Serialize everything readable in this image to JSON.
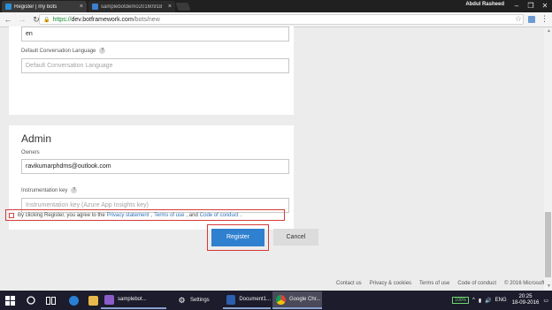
{
  "browser": {
    "tabs": [
      {
        "title": "Register | my bots",
        "close": "×"
      },
      {
        "title": "samplebotdemo20160918",
        "close": "×"
      }
    ],
    "user": "Abdul Rasheed",
    "win_controls": [
      "–",
      "❐",
      "✕"
    ],
    "url": {
      "scheme": "https://",
      "host": "dev.botframework.com",
      "path": "/bots/new"
    }
  },
  "form": {
    "language_value": "en",
    "default_conv_lang": {
      "label": "Default Conversation Language",
      "help": "?",
      "placeholder": "Default Conversation Language"
    },
    "admin": {
      "title": "Admin",
      "owners_label": "Owners",
      "owners_value": "ravikumarphdms@outlook.com",
      "instrumentation_label": "Instrumentation key",
      "instrumentation_help": "?",
      "instrumentation_placeholder": "Instrumentation key (Azure App Insights key)"
    },
    "consent": {
      "prefix": "By clicking Register, you agree to the",
      "privacy": "Privacy statement",
      "sep1": ",",
      "terms": "Terms of use",
      "sep2": ", and",
      "conduct": "Code of conduct",
      "suffix": "."
    },
    "register_label": "Register",
    "cancel_label": "Cancel"
  },
  "footer": {
    "links": [
      "Contact us",
      "Privacy & cookies",
      "Terms of use",
      "Code of conduct"
    ],
    "copyright": "© 2016 Microsoft"
  },
  "taskbar": {
    "vs_label": "samplebot...",
    "settings_label": "Settings",
    "word_label": "Document1...",
    "chrome_label": "Google Chr...",
    "battery": "100%",
    "lang": "ENG",
    "time": "20:25",
    "date": "18-09-2016"
  },
  "colors": {
    "accent": "#2f80cf",
    "highlight_border": "#d43a3a",
    "link": "#2b6fb6"
  }
}
